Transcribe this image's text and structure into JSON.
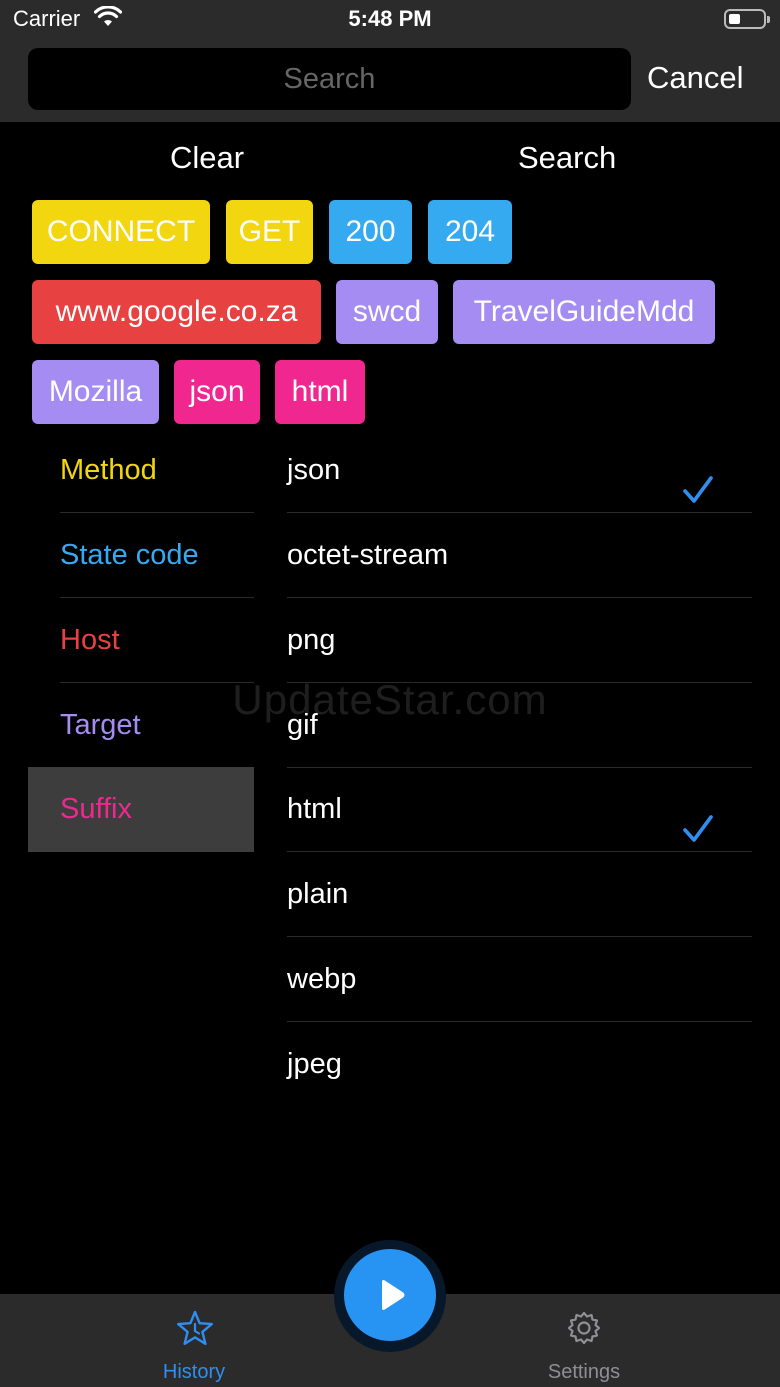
{
  "status": {
    "carrier": "Carrier",
    "time": "5:48 PM",
    "battery_icon": "battery-icon",
    "wifi_icon": "wifi-icon"
  },
  "search": {
    "placeholder": "Search",
    "value": "",
    "cancel_label": "Cancel"
  },
  "actions": {
    "clear_label": "Clear",
    "search_label": "Search"
  },
  "chips": [
    {
      "label": "CONNECT",
      "color": "#f2d60f"
    },
    {
      "label": "GET",
      "color": "#f2d60f"
    },
    {
      "label": "200",
      "color": "#35aaf1"
    },
    {
      "label": "204",
      "color": "#35aaf1"
    },
    {
      "label": "www.google.co.za",
      "color": "#e84142"
    },
    {
      "label": "swcd",
      "color": "#a58cf2"
    },
    {
      "label": "TravelGuideMdd",
      "color": "#a58cf2"
    },
    {
      "label": "Mozilla",
      "color": "#a58cf2"
    },
    {
      "label": "json",
      "color": "#f0278f"
    },
    {
      "label": "html",
      "color": "#f0278f"
    }
  ],
  "categories": [
    {
      "label": "Method",
      "color": "#f2d60f"
    },
    {
      "label": "State code",
      "color": "#35aaf1"
    },
    {
      "label": "Host",
      "color": "#e84142"
    },
    {
      "label": "Target",
      "color": "#a58cf2"
    },
    {
      "label": "Suffix",
      "color": "#f0278f",
      "selected": true
    }
  ],
  "values": [
    {
      "label": "json",
      "checked": true
    },
    {
      "label": "octet-stream",
      "checked": false
    },
    {
      "label": "png",
      "checked": false
    },
    {
      "label": "gif",
      "checked": false
    },
    {
      "label": "html",
      "checked": true
    },
    {
      "label": "plain",
      "checked": false
    },
    {
      "label": "webp",
      "checked": false
    },
    {
      "label": "jpeg",
      "checked": false
    }
  ],
  "checkmark_color": "#2f8ef0",
  "watermark": "UpdateStar.com",
  "tabbar": {
    "history_label": "History",
    "history_icon": "star-icon",
    "settings_label": "Settings",
    "settings_icon": "gear-icon",
    "play_icon": "play-icon",
    "active_color": "#2f8ef0",
    "inactive_color": "#8e8e93"
  }
}
